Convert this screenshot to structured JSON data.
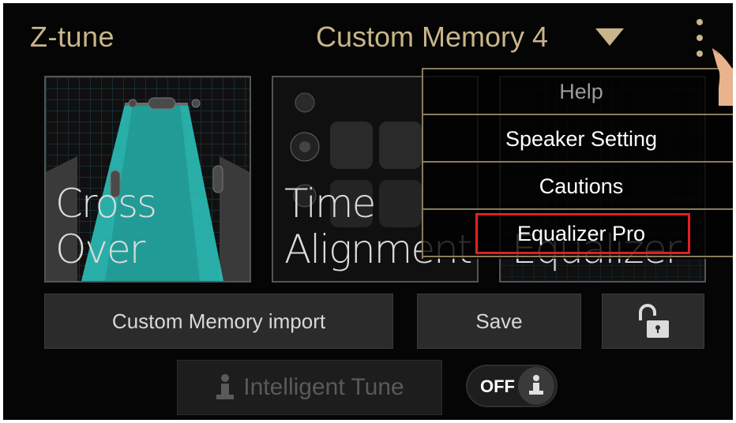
{
  "header": {
    "app_title": "Z-tune",
    "preset_name": "Custom Memory 4"
  },
  "tiles": [
    {
      "line1": "Cross",
      "line2": "Over"
    },
    {
      "line1": "Time",
      "line2": "Alignment"
    },
    {
      "line1": "Equalizer",
      "line2": ""
    }
  ],
  "menu": {
    "items": [
      {
        "label": "Help"
      },
      {
        "label": "Speaker Setting"
      },
      {
        "label": "Cautions"
      },
      {
        "label": "Equalizer Pro"
      }
    ]
  },
  "buttons": {
    "import_label": "Custom Memory import",
    "save_label": "Save"
  },
  "intelligent_tune": {
    "label": "Intelligent Tune",
    "toggle_state": "OFF"
  },
  "colors": {
    "accent_gold": "#c8b589",
    "highlight_red": "#e41e1e",
    "teal": "#2ec9c2"
  },
  "icons": [
    "chevron-down-icon",
    "kebab-menu-icon",
    "hand-pointer-icon",
    "unlock-icon",
    "person-icon"
  ]
}
